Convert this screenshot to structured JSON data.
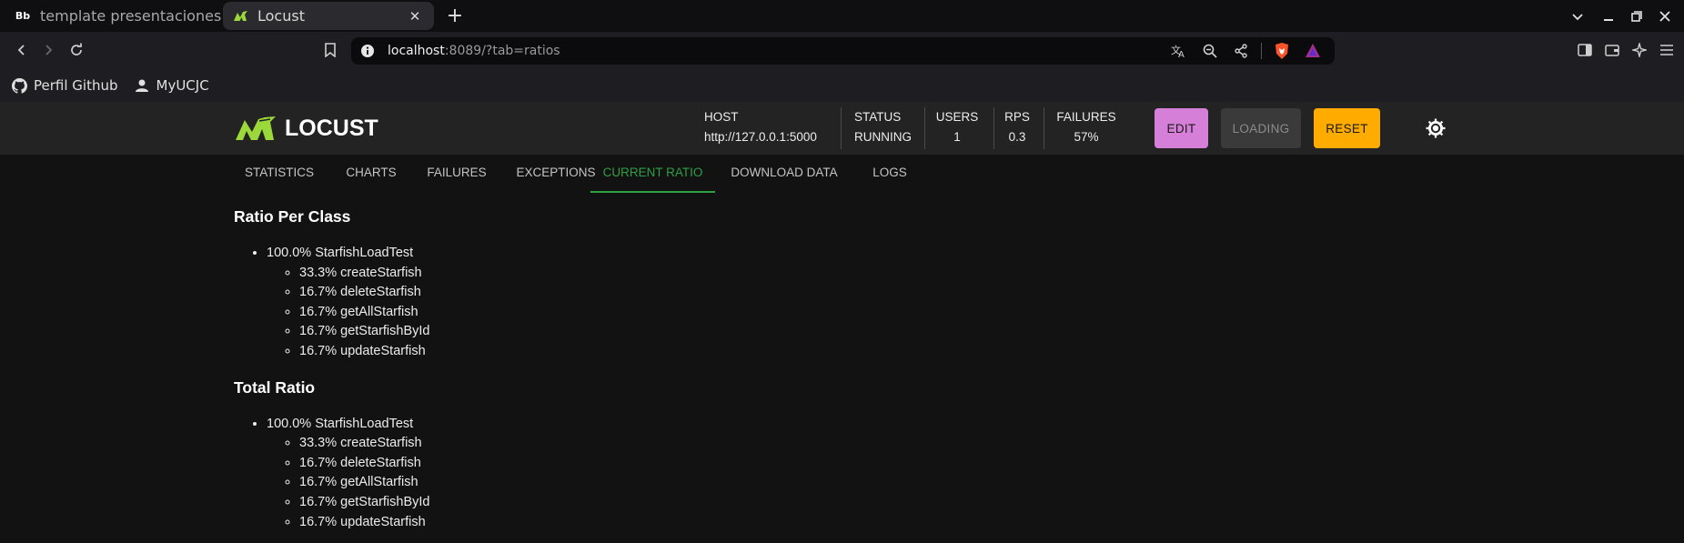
{
  "browser": {
    "tabs": [
      {
        "title": "template presentaciones SE",
        "favicon_text": "Bb",
        "active": false
      },
      {
        "title": "Locust",
        "active": true
      }
    ],
    "url": {
      "host": "localhost",
      "rest": ":8089/?tab=ratios"
    },
    "bookmarks": [
      {
        "label": "Perfil Github",
        "icon": "github-icon"
      },
      {
        "label": "MyUCJC",
        "icon": "user-icon"
      }
    ]
  },
  "locust": {
    "logo_text": "LOCUST",
    "stats": {
      "host": {
        "label": "HOST",
        "value": "http://127.0.0.1:5000"
      },
      "status": {
        "label": "STATUS",
        "value": "RUNNING"
      },
      "users": {
        "label": "USERS",
        "value": "1"
      },
      "rps": {
        "label": "RPS",
        "value": "0.3"
      },
      "failures": {
        "label": "FAILURES",
        "value": "57%"
      }
    },
    "buttons": {
      "edit": "EDIT",
      "loading": "LOADING",
      "reset": "RESET"
    },
    "tabs": [
      {
        "label": "STATISTICS"
      },
      {
        "label": "CHARTS"
      },
      {
        "label": "FAILURES"
      },
      {
        "label": "EXCEPTIONS"
      },
      {
        "label": "CURRENT RATIO"
      },
      {
        "label": "DOWNLOAD DATA"
      },
      {
        "label": "LOGS"
      }
    ],
    "active_tab": "CURRENT RATIO",
    "accent_color": "#2ea043",
    "ratio_per_class": {
      "title": "Ratio Per Class",
      "class": "100.0% StarfishLoadTest",
      "tasks": [
        "33.3% createStarfish",
        "16.7% deleteStarfish",
        "16.7% getAllStarfish",
        "16.7% getStarfishById",
        "16.7% updateStarfish"
      ]
    },
    "total_ratio": {
      "title": "Total Ratio",
      "class": "100.0% StarfishLoadTest",
      "tasks": [
        "33.3% createStarfish",
        "16.7% deleteStarfish",
        "16.7% getAllStarfish",
        "16.7% getStarfishById",
        "16.7% updateStarfish"
      ]
    }
  }
}
